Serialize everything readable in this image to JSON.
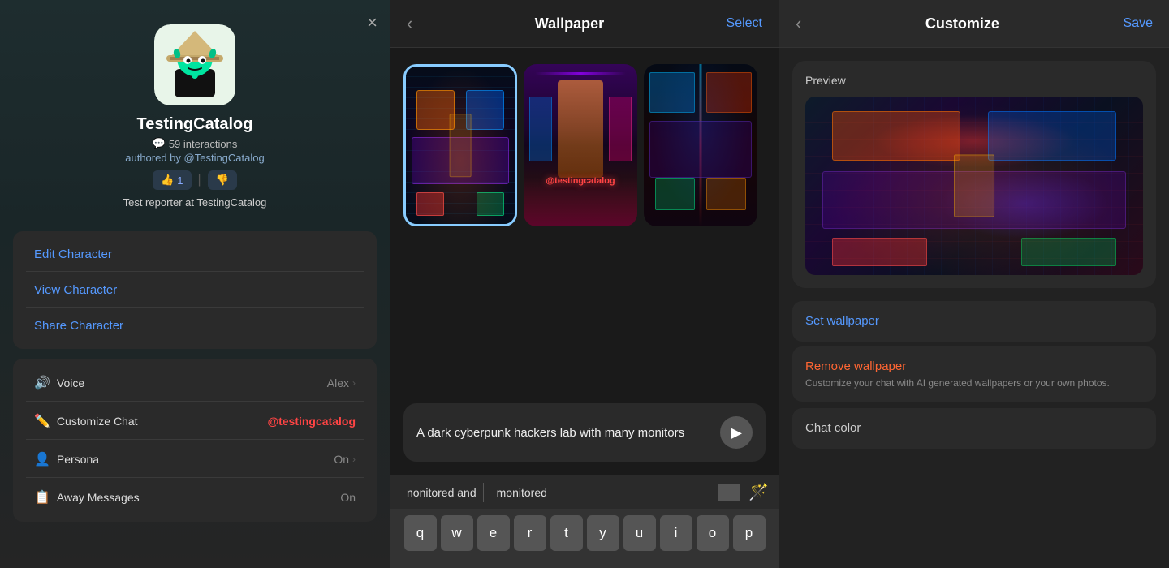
{
  "panel1": {
    "char_name": "TestingCatalog",
    "interactions": "59 interactions",
    "author": "authored by @TestingCatalog",
    "vote_count": "1",
    "description": "Test reporter at TestingCatalog",
    "close_label": "×",
    "menu": {
      "edit": "Edit Character",
      "view": "View Character",
      "share": "Share Character"
    },
    "settings": {
      "voice_label": "Voice",
      "voice_value": "Alex",
      "customize_label": "Customize Chat",
      "customize_highlight": "@testingcatalog",
      "persona_label": "Persona",
      "persona_value": "On",
      "away_label": "Away Messages",
      "away_value": "On"
    }
  },
  "panel2": {
    "back_label": "‹",
    "title": "Wallpaper",
    "select_label": "Select",
    "prompt_text": "A dark cyberpunk hackers lab with many monitors",
    "suggestions": [
      "nonitored and",
      "monitored"
    ],
    "keyboard_rows": [
      [
        "q",
        "w",
        "e",
        "r",
        "t",
        "y",
        "u",
        "i",
        "o",
        "p"
      ]
    ]
  },
  "panel3": {
    "back_label": "‹",
    "title": "Customize",
    "save_label": "Save",
    "preview_label": "Preview",
    "set_wallpaper": "Set wallpaper",
    "remove_wallpaper": "Remove wallpaper",
    "customize_desc": "Customize your chat with AI generated wallpapers or your own photos.",
    "chat_color": "Chat color"
  },
  "watermark": "@testingcatalog",
  "icons": {
    "chat": "💬",
    "thumbs_up": "👍",
    "thumbs_down": "👎",
    "voice": "🔊",
    "brush": "✏️",
    "persona": "👤",
    "away": "📋",
    "send": "▶",
    "grammarly": "G"
  }
}
